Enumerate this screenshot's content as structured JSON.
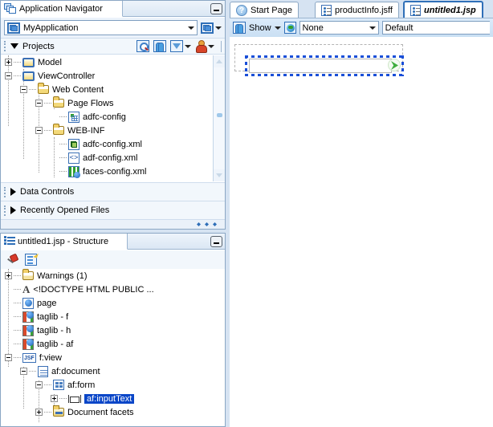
{
  "navigator": {
    "tab_title": "Application Navigator",
    "tab_icon": "application-navigator-icon",
    "minimize_label": "_",
    "application_select": {
      "value": "MyApplication",
      "icon": "application-icon",
      "side_button_icon": "application-menu-icon"
    },
    "projects_section": {
      "label": "Projects",
      "toolbar": [
        {
          "name": "search-icon",
          "label": "Search"
        },
        {
          "name": "refresh-icon",
          "label": "Refresh"
        },
        {
          "name": "filter-icon",
          "label": "Filter"
        },
        {
          "name": "working-sets-icon",
          "label": "Working Sets"
        }
      ]
    },
    "tree": [
      {
        "label": "Model",
        "indent": 0,
        "expander": "plus",
        "icon": "project-folder-icon"
      },
      {
        "label": "ViewController",
        "indent": 0,
        "expander": "minus",
        "icon": "project-folder-icon"
      },
      {
        "label": "Web Content",
        "indent": 1,
        "expander": "minus",
        "icon": "folder-icon"
      },
      {
        "label": "Page Flows",
        "indent": 2,
        "expander": "minus",
        "icon": "folder-icon"
      },
      {
        "label": "adfc-config",
        "indent": 3,
        "expander": "none",
        "icon": "page-flow-icon"
      },
      {
        "label": "WEB-INF",
        "indent": 2,
        "expander": "minus",
        "icon": "folder-icon"
      },
      {
        "label": "adfc-config.xml",
        "indent": 3,
        "expander": "none",
        "icon": "adfc-config-xml-icon"
      },
      {
        "label": "adf-config.xml",
        "indent": 3,
        "expander": "none",
        "icon": "xml-code-icon"
      },
      {
        "label": "faces-config.xml",
        "indent": 3,
        "expander": "none",
        "icon": "faces-config-icon"
      }
    ],
    "collapsed_sections": [
      {
        "label": "Data Controls"
      },
      {
        "label": "Recently Opened Files"
      }
    ]
  },
  "structure": {
    "tab_title": "untitled1.jsp - Structure",
    "tab_icon": "structure-icon",
    "minimize_label": "_",
    "toolbar": [
      {
        "name": "pin-icon",
        "label": "Pin"
      },
      {
        "name": "edit-icon",
        "label": "Edit"
      }
    ],
    "tree": [
      {
        "label": "Warnings (1)",
        "indent": 0,
        "expander": "plus",
        "icon": "warnings-folder-icon",
        "selected": false
      },
      {
        "label": "<!DOCTYPE HTML PUBLIC ...",
        "indent": 0,
        "expander": "none",
        "icon": "doctype-icon",
        "selected": false
      },
      {
        "label": "page",
        "indent": 0,
        "expander": "none",
        "icon": "page-directive-icon",
        "selected": false
      },
      {
        "label": "taglib - f",
        "indent": 0,
        "expander": "none",
        "icon": "taglib-icon",
        "selected": false
      },
      {
        "label": "taglib - h",
        "indent": 0,
        "expander": "none",
        "icon": "taglib-icon",
        "selected": false
      },
      {
        "label": "taglib - af",
        "indent": 0,
        "expander": "none",
        "icon": "taglib-icon",
        "selected": false
      },
      {
        "label": "f:view",
        "indent": 0,
        "expander": "minus",
        "icon": "jsf-icon",
        "selected": false
      },
      {
        "label": "af:document",
        "indent": 1,
        "expander": "minus",
        "icon": "document-icon",
        "selected": false
      },
      {
        "label": "af:form",
        "indent": 2,
        "expander": "minus",
        "icon": "form-icon",
        "selected": false
      },
      {
        "label": "af:inputText",
        "indent": 3,
        "expander": "plus",
        "icon": "input-text-icon",
        "selected": true
      },
      {
        "label": "Document facets",
        "indent": 2,
        "expander": "plus",
        "icon": "facets-folder-icon",
        "selected": false
      }
    ]
  },
  "editor": {
    "tabs": [
      {
        "label": "Start Page",
        "icon": "help-icon",
        "active": false
      },
      {
        "label": "productInfo.jsff",
        "icon": "jsff-icon",
        "active": false
      },
      {
        "label": "untitled1.jsp",
        "icon": "jsp-icon",
        "active": true
      }
    ],
    "toolbar": {
      "refresh_icon": "refresh-icon",
      "show_label": "Show",
      "globe_icon": "globe-icon",
      "facet_select_value": "None",
      "skin_value": "Default"
    },
    "canvas": {
      "selected_component": "af:inputText",
      "indicator_icon": "partial-submit-icon"
    }
  },
  "colors": {
    "accent": "#2f6fb8",
    "selection": "#0a46c8",
    "panel_bg": "#d6e3f2",
    "dashed_selection": "#1a4fd8"
  }
}
